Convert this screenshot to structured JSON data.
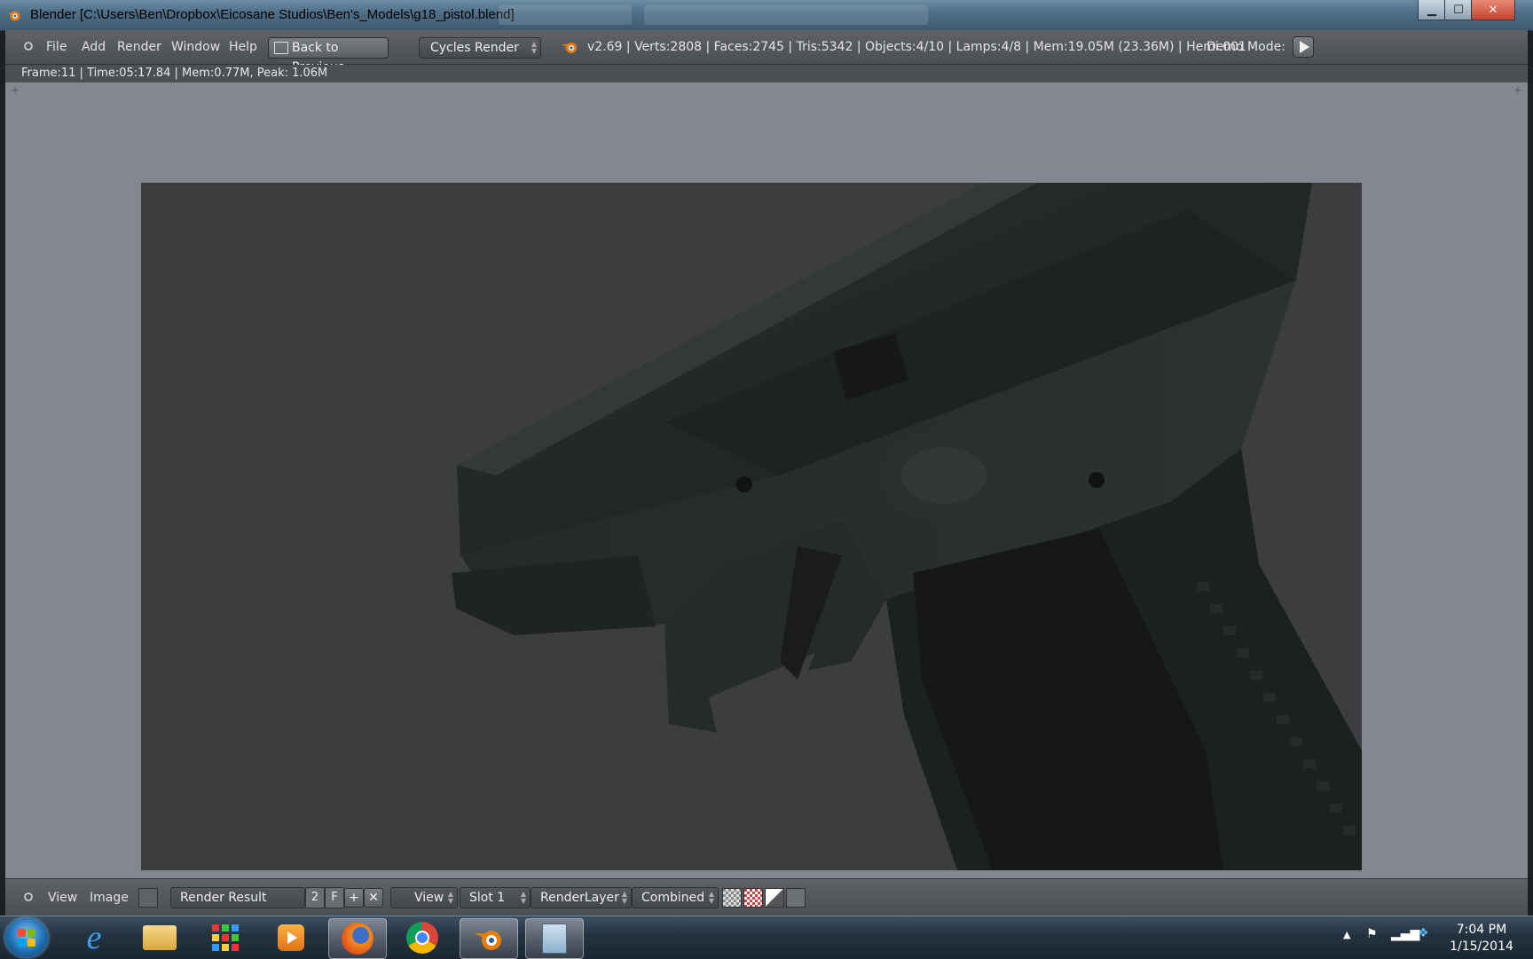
{
  "window": {
    "title": "Blender  [C:\\Users\\Ben\\Dropbox\\Eicosane Studios\\Ben's_Models\\g18_pistol.blend]",
    "controls": {
      "minimize": "▁",
      "maximize": "☐",
      "close": "✕"
    }
  },
  "header": {
    "menus": [
      "File",
      "Add",
      "Render",
      "Window",
      "Help"
    ],
    "back_button": "Back to Previous",
    "render_engine": "Cycles Render",
    "stats": "v2.69 | Verts:2808 | Faces:2745 | Tris:5342 | Objects:4/10 | Lamps:4/8 | Mem:19.05M (23.36M) | Hemi.001",
    "demo_mode_label": "Demo Mode:"
  },
  "render_info": "Frame:11 | Time:05:17.84 | Mem:0.77M, Peak: 1.06M",
  "image_editor": {
    "menus": [
      "View",
      "Image"
    ],
    "image_name": "Render Result",
    "users_count": "2",
    "fake_user": "F",
    "new_button": "+",
    "unlink_button": "✕",
    "view_select": "View",
    "slot_select": "Slot 1",
    "layer_select": "RenderLayer",
    "pass_select": "Combined"
  },
  "taskbar": {
    "apps": [
      "internet-explorer",
      "file-explorer",
      "app-grid",
      "media-player",
      "firefox",
      "chrome",
      "blender",
      "calculator"
    ],
    "active_app": "blender",
    "clock_time": "7:04 PM",
    "clock_date": "1/15/2014"
  },
  "colors": {
    "blender_orange": "#e87d0d",
    "titlebar": "#4f6f88",
    "header": "#55585d",
    "viewport": "#83878f",
    "render_bg": "#3c3d3f"
  }
}
